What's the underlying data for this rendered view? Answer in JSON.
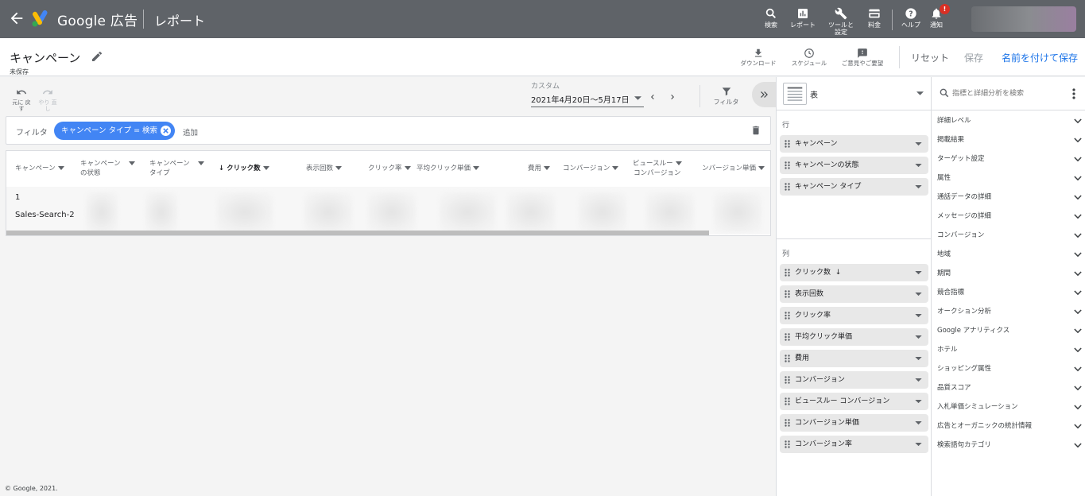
{
  "topbar": {
    "brand": "Google 広告",
    "section": "レポート",
    "tools": [
      {
        "label": "検索",
        "icon": "search-icon"
      },
      {
        "label": "レポート",
        "icon": "reports-icon"
      },
      {
        "label": "ツールと 設定",
        "icon": "wrench-icon"
      },
      {
        "label": "料金",
        "icon": "billing-icon"
      },
      {
        "label": "ヘルプ",
        "icon": "help-icon"
      },
      {
        "label": "通知",
        "icon": "bell-icon"
      }
    ],
    "notification_badge": "!",
    "colors": {
      "bar": "#5f6368",
      "badge": "#d93025"
    }
  },
  "titlebar": {
    "title": "キャンペーン",
    "status": "未保存",
    "tools": [
      {
        "label": "ダウンロード",
        "icon": "download-icon"
      },
      {
        "label": "スケジュール",
        "icon": "clock-icon"
      },
      {
        "label": "ご意見やご要望",
        "icon": "feedback-icon"
      }
    ],
    "reset": "リセット",
    "save": "保存",
    "save_as": "名前を付けて保存",
    "colors": {
      "link": "#1a73e8",
      "disabled": "#9aa0a6"
    }
  },
  "toolbar": {
    "undo": "元に 戻す",
    "redo": "やり 直し",
    "date_label": "カスタム",
    "date_range": "2021年4月20日〜5月17日",
    "filter": "フィルタ"
  },
  "filter_bar": {
    "label": "フィルタ",
    "chip": "キャンペーン タイプ = 検索",
    "add": "追加",
    "chip_color": "#4285f4"
  },
  "table": {
    "headers": [
      {
        "line1": "キャンペーン",
        "line2": ""
      },
      {
        "line1": "キャンペーン",
        "line2": "の状態"
      },
      {
        "line1": "キャンペーン",
        "line2": "タイプ"
      },
      {
        "line1": "クリック数",
        "line2": ""
      },
      {
        "line1": "表示回数",
        "line2": ""
      },
      {
        "line1": "クリック率",
        "line2": ""
      },
      {
        "line1": "平均クリック単価",
        "line2": ""
      },
      {
        "line1": "費用",
        "line2": ""
      },
      {
        "line1": "コンバージョン",
        "line2": ""
      },
      {
        "line1": "ビュースルー",
        "line2": "コンバージョン"
      },
      {
        "line1": "コンバージョン単価",
        "line2": ""
      }
    ],
    "rows": [
      {
        "campaign": "1"
      },
      {
        "campaign": "Sales-Search-2"
      }
    ]
  },
  "viz": {
    "type_label": "表"
  },
  "rows_section": {
    "title": "行",
    "items": [
      "キャンペーン",
      "キャンペーンの状態",
      "キャンペーン タイプ"
    ]
  },
  "cols_section": {
    "title": "列",
    "items": [
      "クリック数",
      "表示回数",
      "クリック率",
      "平均クリック単価",
      "費用",
      "コンバージョン",
      "ビュースルー コンバージョン",
      "コンバージョン単価",
      "コンバージョン率"
    ]
  },
  "dimensions": {
    "search_placeholder": "指標と詳細分析を検索",
    "items": [
      "詳細レベル",
      "掲載結果",
      "ターゲット設定",
      "属性",
      "通話データの詳細",
      "メッセージの詳細",
      "コンバージョン",
      "地域",
      "期間",
      "競合指標",
      "オークション分析",
      "Google アナリティクス",
      "ホテル",
      "ショッピング属性",
      "品質スコア",
      "入札単価シミュレーション",
      "広告とオーガニックの統計情報",
      "検索語句カテゴリ"
    ]
  },
  "footer": {
    "copyright": "© Google, 2021."
  }
}
